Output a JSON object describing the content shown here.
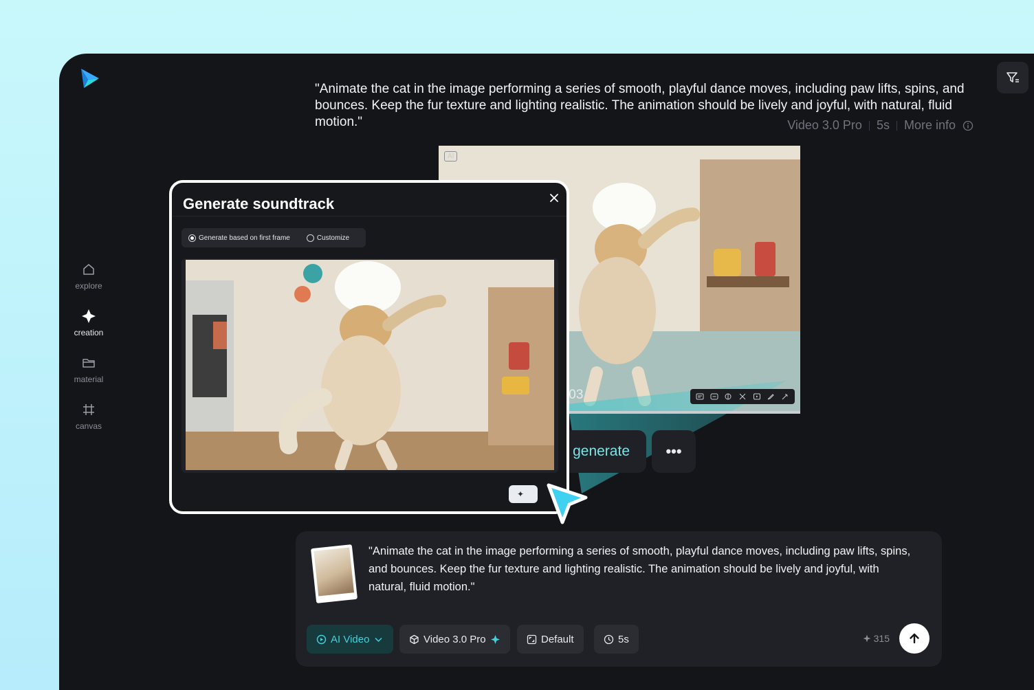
{
  "prompt": {
    "text": "\"Animate the cat in the image performing a series of smooth, playful dance moves, including paw lifts, spins, and bounces. Keep the fur texture and lighting realistic. The animation should be lively and joyful, with natural, fluid motion.\""
  },
  "meta": {
    "model": "Video 3.0 Pro",
    "duration": "5s",
    "more_info": "More info"
  },
  "video": {
    "ai_badge": "AI",
    "timecode": ":03",
    "progress": 1.0
  },
  "actions": {
    "regenerate": "generate",
    "more": "•••"
  },
  "sidebar": {
    "items": [
      {
        "label": "explore"
      },
      {
        "label": "creation"
      },
      {
        "label": "material"
      },
      {
        "label": "canvas"
      }
    ]
  },
  "modal": {
    "title": "Generate soundtrack",
    "options": [
      {
        "label": "Generate based on first frame",
        "checked": true
      },
      {
        "label": "Customize",
        "checked": false
      }
    ],
    "action_icon": "✦"
  },
  "composer": {
    "text": "\"Animate the cat in the image performing a series of smooth, playful dance moves, including paw lifts, spins, and bounces. Keep the fur texture and lighting realistic. The animation should be lively and joyful, with natural, fluid motion.\"",
    "chips": {
      "mode": "AI Video",
      "model": "Video 3.0 Pro",
      "ratio": "Default",
      "duration": "5s"
    },
    "credits": "315"
  },
  "colors": {
    "accent": "#41d2dc",
    "background": "#141519"
  }
}
